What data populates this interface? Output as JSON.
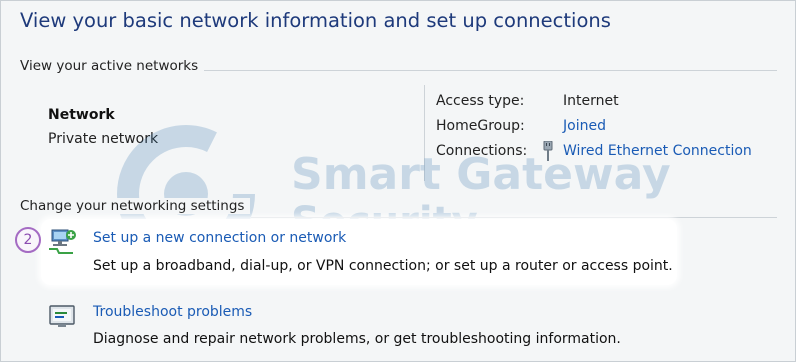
{
  "page": {
    "title": "View your basic network information and set up connections"
  },
  "active_networks": {
    "section_label": "View your active networks",
    "network_name": "Network",
    "network_category": "Private network",
    "details": [
      {
        "label": "Access type:",
        "value": "Internet",
        "is_link": false
      },
      {
        "label": "HomeGroup:",
        "value": "Joined",
        "is_link": true
      },
      {
        "label": "Connections:",
        "value": "Wired Ethernet Connection",
        "is_link": true,
        "icon": "ethernet-icon"
      }
    ]
  },
  "settings": {
    "section_label": "Change your networking settings",
    "step_badge": "2",
    "tasks": [
      {
        "title": "Set up a new connection or network",
        "description": "Set up a broadband, dial-up, or VPN connection; or set up a router or access point.",
        "icon": "new-connection-icon",
        "highlighted": true
      },
      {
        "title": "Troubleshoot problems",
        "description": "Diagnose and repair network problems, or get troubleshooting information.",
        "icon": "troubleshoot-icon",
        "highlighted": false
      }
    ]
  },
  "watermark": {
    "line1": "Smart Gateway",
    "line2": "Security"
  },
  "colors": {
    "title": "#1e3a7b",
    "link": "#1a5bb5",
    "badge": "#a46bc3"
  }
}
